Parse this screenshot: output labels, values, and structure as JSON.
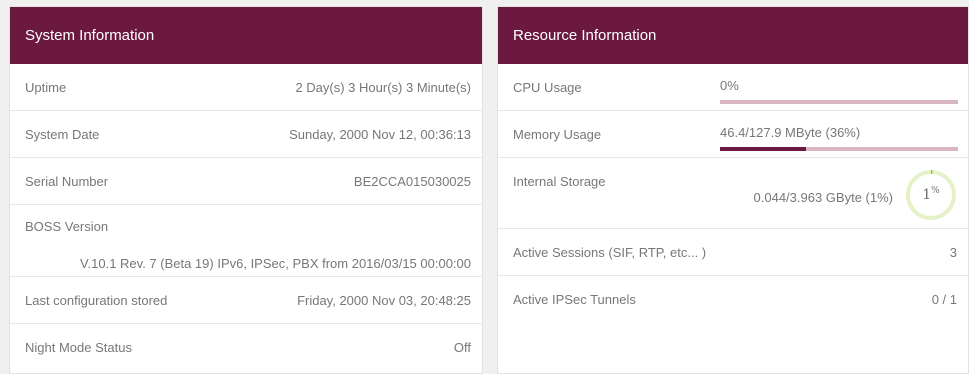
{
  "system": {
    "title": "System Information",
    "rows": [
      {
        "label": "Uptime",
        "value": "2 Day(s) 3 Hour(s) 3 Minute(s)"
      },
      {
        "label": "System Date",
        "value": "Sunday, 2000 Nov 12, 00:36:13"
      },
      {
        "label": "Serial Number",
        "value": "BE2CCA015030025"
      },
      {
        "label": "BOSS Version",
        "value": "V.10.1 Rev. 7 (Beta 19) IPv6, IPSec, PBX from 2016/03/15 00:00:00"
      },
      {
        "label": "Last configuration stored",
        "value": "Friday, 2000 Nov 03, 20:48:25"
      },
      {
        "label": "Night Mode Status",
        "value": "Off"
      }
    ]
  },
  "resource": {
    "title": "Resource Information",
    "cpu": {
      "label": "CPU Usage",
      "value": "0%",
      "fraction": 0
    },
    "memory": {
      "label": "Memory Usage",
      "value": "46.4/127.9 MByte (36%)",
      "fraction": 0.36
    },
    "storage": {
      "label": "Internal Storage",
      "value": "0.044/3.963 GByte (1%)",
      "gauge_number": "1",
      "gauge_unit": "%",
      "fraction": 0.01
    },
    "sessions": {
      "label": "Active Sessions (SIF, RTP, etc... )",
      "value": "3"
    },
    "ipsec": {
      "label": "Active IPSec Tunnels",
      "value": "0 / 1"
    }
  },
  "colors": {
    "header": "#6c1941",
    "bar_track": "#d8b6c4",
    "gauge_track": "#e5f2c8",
    "gauge_fill": "#8cc63f"
  }
}
